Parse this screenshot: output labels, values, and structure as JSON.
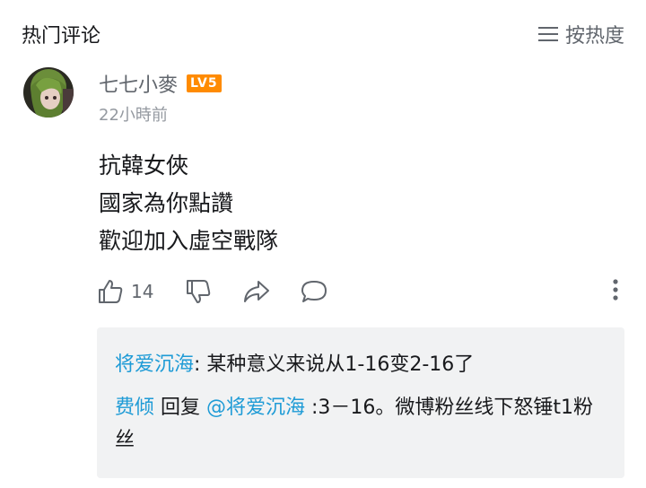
{
  "header": {
    "title": "热门评论",
    "sort_label": "按热度"
  },
  "comment": {
    "username": "七七小麥",
    "level": "LV5",
    "time": "22小時前",
    "lines": [
      "抗韓女俠",
      "國家為你點讚",
      "歡迎加入虛空戰隊"
    ],
    "like_count": "14"
  },
  "replies": [
    {
      "user": "将爱沉海",
      "separator": ":",
      "text": " 某种意义来说从1-16变2-16了"
    },
    {
      "user": "费倾",
      "reply_word": " 回复 ",
      "mention": "@将爱沉海",
      "text": " :3－16。微博粉丝线下怒锤t1粉丝"
    }
  ],
  "colors": {
    "accent_link": "#1e9bd6",
    "level_badge": "#ff8b00",
    "secondary_text": "#61666d",
    "reply_background": "#f1f2f3"
  },
  "icons": [
    "menu-lines-icon",
    "thumbs-up-icon",
    "thumbs-down-icon",
    "share-icon",
    "comment-icon",
    "more-vertical-icon"
  ]
}
